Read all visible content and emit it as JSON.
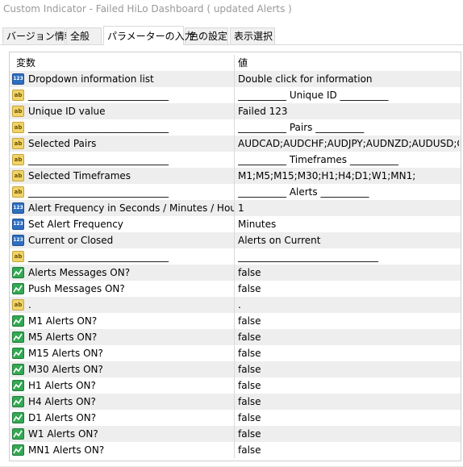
{
  "window": {
    "title": "Custom Indicator - Failed HiLo Dashboard ( updated Alerts )"
  },
  "tabs": [
    {
      "label": "バージョン情報",
      "active": false
    },
    {
      "label": "全般",
      "active": false
    },
    {
      "label": "パラメーターの入力",
      "active": true
    },
    {
      "label": "色の設定",
      "active": false
    },
    {
      "label": "表示選択",
      "active": false
    }
  ],
  "table": {
    "headers": {
      "name": "変数",
      "value": "値"
    },
    "rows": [
      {
        "icon": "number-icon",
        "name": "Dropdown information list",
        "value": "Double click for information"
      },
      {
        "icon": "string-icon",
        "name": "_____________________________",
        "value": "__________ Unique ID __________"
      },
      {
        "icon": "string-icon",
        "name": "Unique ID value",
        "value": "Failed 123"
      },
      {
        "icon": "string-icon",
        "name": "_____________________________",
        "value": "__________ Pairs __________"
      },
      {
        "icon": "string-icon",
        "name": "Selected Pairs",
        "value": "AUDCAD;AUDCHF;AUDJPY;AUDNZD;AUDUSD;CA..."
      },
      {
        "icon": "string-icon",
        "name": "_____________________________",
        "value": "__________ Timeframes __________"
      },
      {
        "icon": "string-icon",
        "name": "Selected Timeframes",
        "value": "M1;M5;M15;M30;H1;H4;D1;W1;MN1;"
      },
      {
        "icon": "string-icon",
        "name": "_____________________________",
        "value": "__________ Alerts __________"
      },
      {
        "icon": "number-icon",
        "name": "Alert Frequency in Seconds / Minutes / Hours",
        "value": "1"
      },
      {
        "icon": "number-icon",
        "name": "Set Alert Frequency",
        "value": "Minutes"
      },
      {
        "icon": "number-icon",
        "name": "Current or Closed",
        "value": "Alerts on Current"
      },
      {
        "icon": "string-icon",
        "name": "_____________________________",
        "value": "_____________________________"
      },
      {
        "icon": "bool-icon",
        "name": "Alerts Messages ON?",
        "value": "false"
      },
      {
        "icon": "bool-icon",
        "name": "Push Messages ON?",
        "value": "false"
      },
      {
        "icon": "string-icon",
        "name": ".",
        "value": "."
      },
      {
        "icon": "bool-icon",
        "name": "M1 Alerts ON?",
        "value": "false"
      },
      {
        "icon": "bool-icon",
        "name": "M5 Alerts ON?",
        "value": "false"
      },
      {
        "icon": "bool-icon",
        "name": "M15 Alerts ON?",
        "value": "false"
      },
      {
        "icon": "bool-icon",
        "name": "M30 Alerts ON?",
        "value": "false"
      },
      {
        "icon": "bool-icon",
        "name": "H1 Alerts ON?",
        "value": "false"
      },
      {
        "icon": "bool-icon",
        "name": "H4 Alerts ON?",
        "value": "false"
      },
      {
        "icon": "bool-icon",
        "name": "D1 Alerts ON?",
        "value": "false"
      },
      {
        "icon": "bool-icon",
        "name": "W1 Alerts ON?",
        "value": "false"
      },
      {
        "icon": "bool-icon",
        "name": "MN1 Alerts ON?",
        "value": "false"
      }
    ]
  },
  "icon_glyphs": {
    "number": "123",
    "string": "ab"
  },
  "colors": {
    "row_alt": "#eeeeee",
    "number_icon": "#2e6fbf",
    "string_icon": "#f0d46a",
    "bool_icon": "#34a853"
  }
}
